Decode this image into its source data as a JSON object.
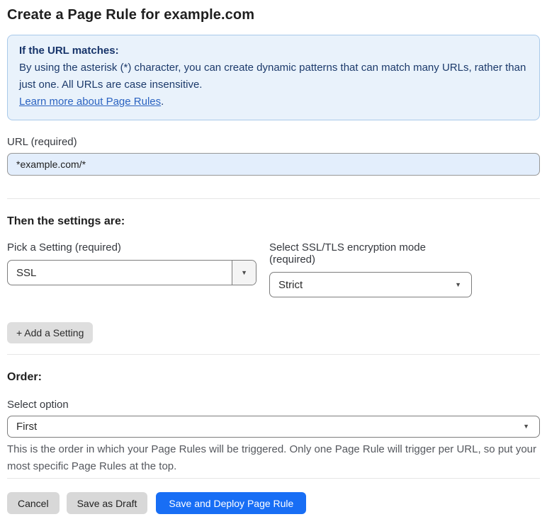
{
  "page": {
    "title": "Create a Page Rule for example.com"
  },
  "info_box": {
    "heading": "If the URL matches:",
    "body": "By using the asterisk (*) character, you can create dynamic patterns that can match many URLs, rather than just one. All URLs are case insensitive.",
    "link_label": "Learn more about Page Rules",
    "link_suffix": "."
  },
  "url_field": {
    "label": "URL (required)",
    "value": "*example.com/*"
  },
  "settings": {
    "heading": "Then the settings are:",
    "setting_select": {
      "label": "Pick a Setting (required)",
      "value": "SSL"
    },
    "mode_select": {
      "label": "Select SSL/TLS encryption mode (required)",
      "value": "Strict"
    },
    "add_setting_label": "+ Add a Setting"
  },
  "order": {
    "heading": "Order:",
    "select_label": "Select option",
    "value": "First",
    "help_text": "This is the order in which your Page Rules will be triggered. Only one Page Rule will trigger per URL, so put your most specific Page Rules at the top."
  },
  "actions": {
    "cancel": "Cancel",
    "save_draft": "Save as Draft",
    "save_deploy": "Save and Deploy Page Rule"
  },
  "icons": {
    "dropdown_arrow": "▼"
  },
  "colors": {
    "primary_blue": "#186ef5",
    "info_background": "#e9f2fb",
    "info_border": "#a9c9ea",
    "info_text": "#1c3a6b",
    "link_blue": "#2b63c1",
    "input_background": "#e3eefc",
    "button_gray": "#d8d8d8"
  }
}
